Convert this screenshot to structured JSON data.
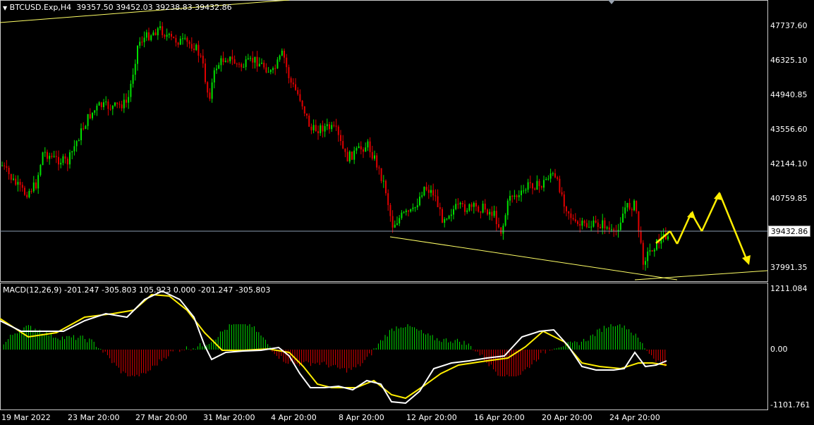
{
  "header": {
    "symbol": "BTCUSD.Exp,H4",
    "ohlc": "39357.50 39452.03 39238.83 39432.86",
    "menu_arrow": "triangle-down-icon"
  },
  "price_axis": [
    "47737.60",
    "46325.10",
    "44940.85",
    "43556.60",
    "42144.10",
    "40759.85",
    "37991.35"
  ],
  "current_price": "39432.86",
  "macd": {
    "label": "MACD(12,26,9) -201.247 -305.803 105.923 0.000 -201.247 -305.803",
    "axis": [
      "1211.084",
      "0.00",
      "-1101.761"
    ]
  },
  "time_axis": [
    "19 Mar 2022",
    "23 Mar 20:00",
    "27 Mar 20:00",
    "31 Mar 20:00",
    "4 Apr 20:00",
    "8 Apr 20:00",
    "12 Apr 20:00",
    "16 Apr 20:00",
    "20 Apr 20:00",
    "24 Apr 20:00"
  ],
  "colors": {
    "bull": "#00e000",
    "bear": "#e00000",
    "trend": "#ffff66",
    "arrow": "#ffee00",
    "macd_line": "#ffffff",
    "signal_line": "#ffee00"
  }
}
